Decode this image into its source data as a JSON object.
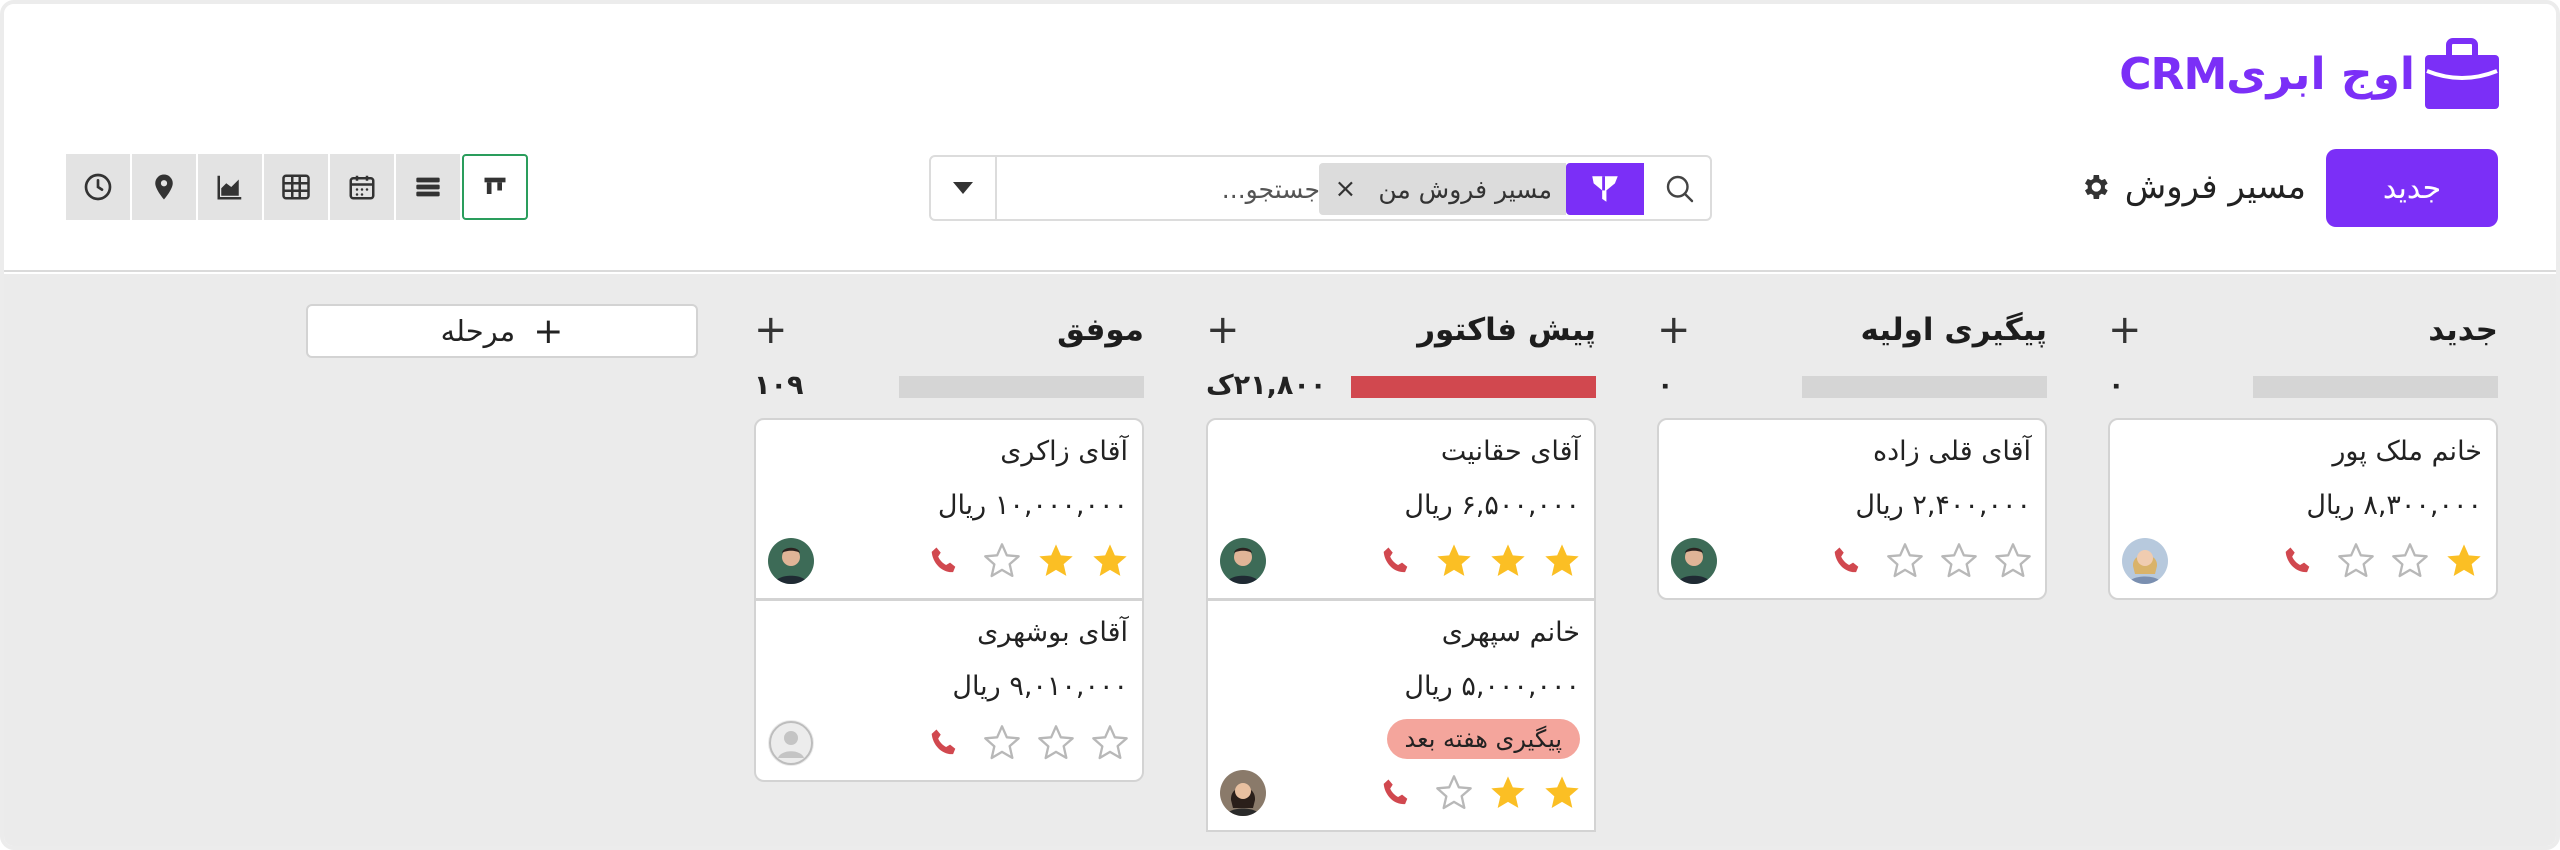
{
  "app": {
    "logo_text": "CRMاوج ابری",
    "accent": "#7b2ff7"
  },
  "toolbar": {
    "new_label": "جدید",
    "pipeline_title": "مسیر فروش",
    "filter_chip": "مسیر فروش من",
    "search_placeholder": "جستجو...",
    "views": [
      "history-icon",
      "map-pin-icon",
      "chart-icon",
      "table-icon",
      "calendar-icon",
      "list-icon",
      "kanban-icon"
    ],
    "active_view": "kanban-icon"
  },
  "board": {
    "add_stage_label": "مرحله",
    "columns": [
      {
        "title": "جدید",
        "total": "۰",
        "fill": 0,
        "cards": [
          {
            "name": "خانم ملک پور",
            "amount": "۸,۳۰۰,۰۰۰ ریال",
            "stars": 1,
            "avatar": "female"
          }
        ]
      },
      {
        "title": "پیگیری اولیه",
        "total": "۰",
        "fill": 0,
        "cards": [
          {
            "name": "آقای قلی زاده",
            "amount": "۲,۴۰۰,۰۰۰ ریال",
            "stars": 0,
            "avatar": "male"
          }
        ]
      },
      {
        "title": "پیش فاکتور",
        "total": "۲۱,۸۰۰ک",
        "fill": 1,
        "cards": [
          {
            "name": "آقای حقانیت",
            "amount": "۶,۵۰۰,۰۰۰ ریال",
            "stars": 3,
            "avatar": "male"
          },
          {
            "name": "خانم سپهری",
            "amount": "۵,۰۰۰,۰۰۰ ریال",
            "stars": 2,
            "avatar": "female",
            "tag": "پیگیری هفته بعد"
          }
        ]
      },
      {
        "title": "موفق",
        "total": "۱۰۹",
        "fill": 0,
        "cards": [
          {
            "name": "آقای زاکری",
            "amount": "۱۰,۰۰۰,۰۰۰ ریال",
            "stars": 2,
            "avatar": "male"
          },
          {
            "name": "آقای بوشهری",
            "amount": "۹,۰۱۰,۰۰۰ ریال",
            "stars": 0,
            "avatar": "placeholder"
          }
        ]
      }
    ]
  },
  "colors": {
    "star_on": "#fbbf24",
    "star_off": "#b8b8b8",
    "phone": "#d1484f",
    "bar_fill": "#d1484f",
    "tag_bg": "#f4a59c",
    "active_view_border": "#2a9d5c"
  }
}
